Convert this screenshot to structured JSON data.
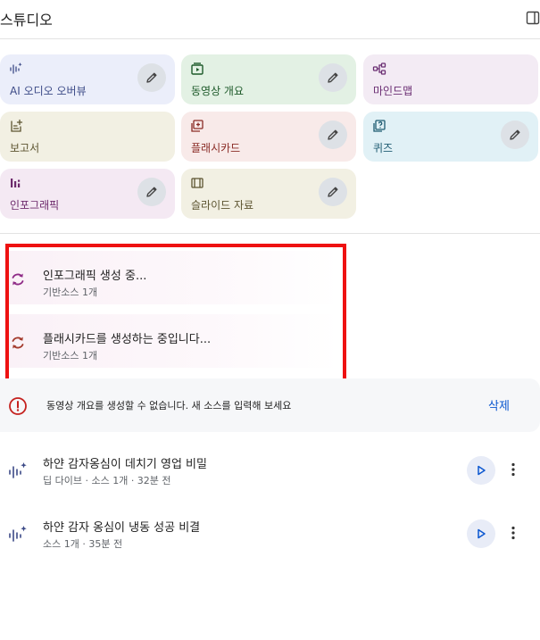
{
  "header": {
    "title": "스튜디오",
    "panel_icon": "panel-toggle-icon"
  },
  "tiles": [
    {
      "label": "AI 오디오 오버뷰",
      "icon": "audio-waveform-icon",
      "bg": "#ebeefa",
      "fg": "#3c4a87",
      "editable": true
    },
    {
      "label": "동영상 개요",
      "icon": "video-icon",
      "bg": "#e3f1e4",
      "fg": "#1e5a2a",
      "editable": true
    },
    {
      "label": "마인드맵",
      "icon": "mindmap-icon",
      "bg": "#f3ebf4",
      "fg": "#6a2d72",
      "editable": false
    },
    {
      "label": "보고서",
      "icon": "report-icon",
      "bg": "#f2f0e3",
      "fg": "#5c5430",
      "editable": false
    },
    {
      "label": "플래시카드",
      "icon": "flashcard-icon",
      "bg": "#f8eae9",
      "fg": "#8a2c26",
      "editable": true
    },
    {
      "label": "퀴즈",
      "icon": "quiz-icon",
      "bg": "#e1f1f6",
      "fg": "#1f5c72",
      "editable": true
    },
    {
      "label": "인포그래픽",
      "icon": "infographic-icon",
      "bg": "#f4e9f3",
      "fg": "#6d2a6c",
      "editable": true
    },
    {
      "label": "슬라이드 자료",
      "icon": "slides-icon",
      "bg": "#f2f0e3",
      "fg": "#5c5430",
      "editable": true
    }
  ],
  "generating": [
    {
      "title": "인포그래픽 생성 중...",
      "subtitle": "기반소스 1개",
      "icon": "sync-icon",
      "color": "#8e2a86"
    },
    {
      "title": "플래시카드를 생성하는 중입니다...",
      "subtitle": "기반소스 1개",
      "icon": "sync-icon",
      "color": "#a33a2c"
    }
  ],
  "error": {
    "message": "동영상 개요를 생성할 수 없습니다. 새 소스를 입력해 보세요",
    "delete_label": "삭제",
    "icon": "error-circle-icon",
    "color": "#c5221f"
  },
  "audio_items": [
    {
      "title": "하얀 감자옹심이 데치기 영업 비밀",
      "subtitle": "딥 다이브 · 소스 1개 · 32분 전",
      "icon": "audio-waveform-icon"
    },
    {
      "title": "하얀 감자 옹심이 냉동 성공 비결",
      "subtitle": "소스 1개 · 35분 전",
      "icon": "audio-waveform-icon"
    }
  ],
  "colors": {
    "accent": "#0b57d0",
    "highlight": "#ee1111"
  }
}
